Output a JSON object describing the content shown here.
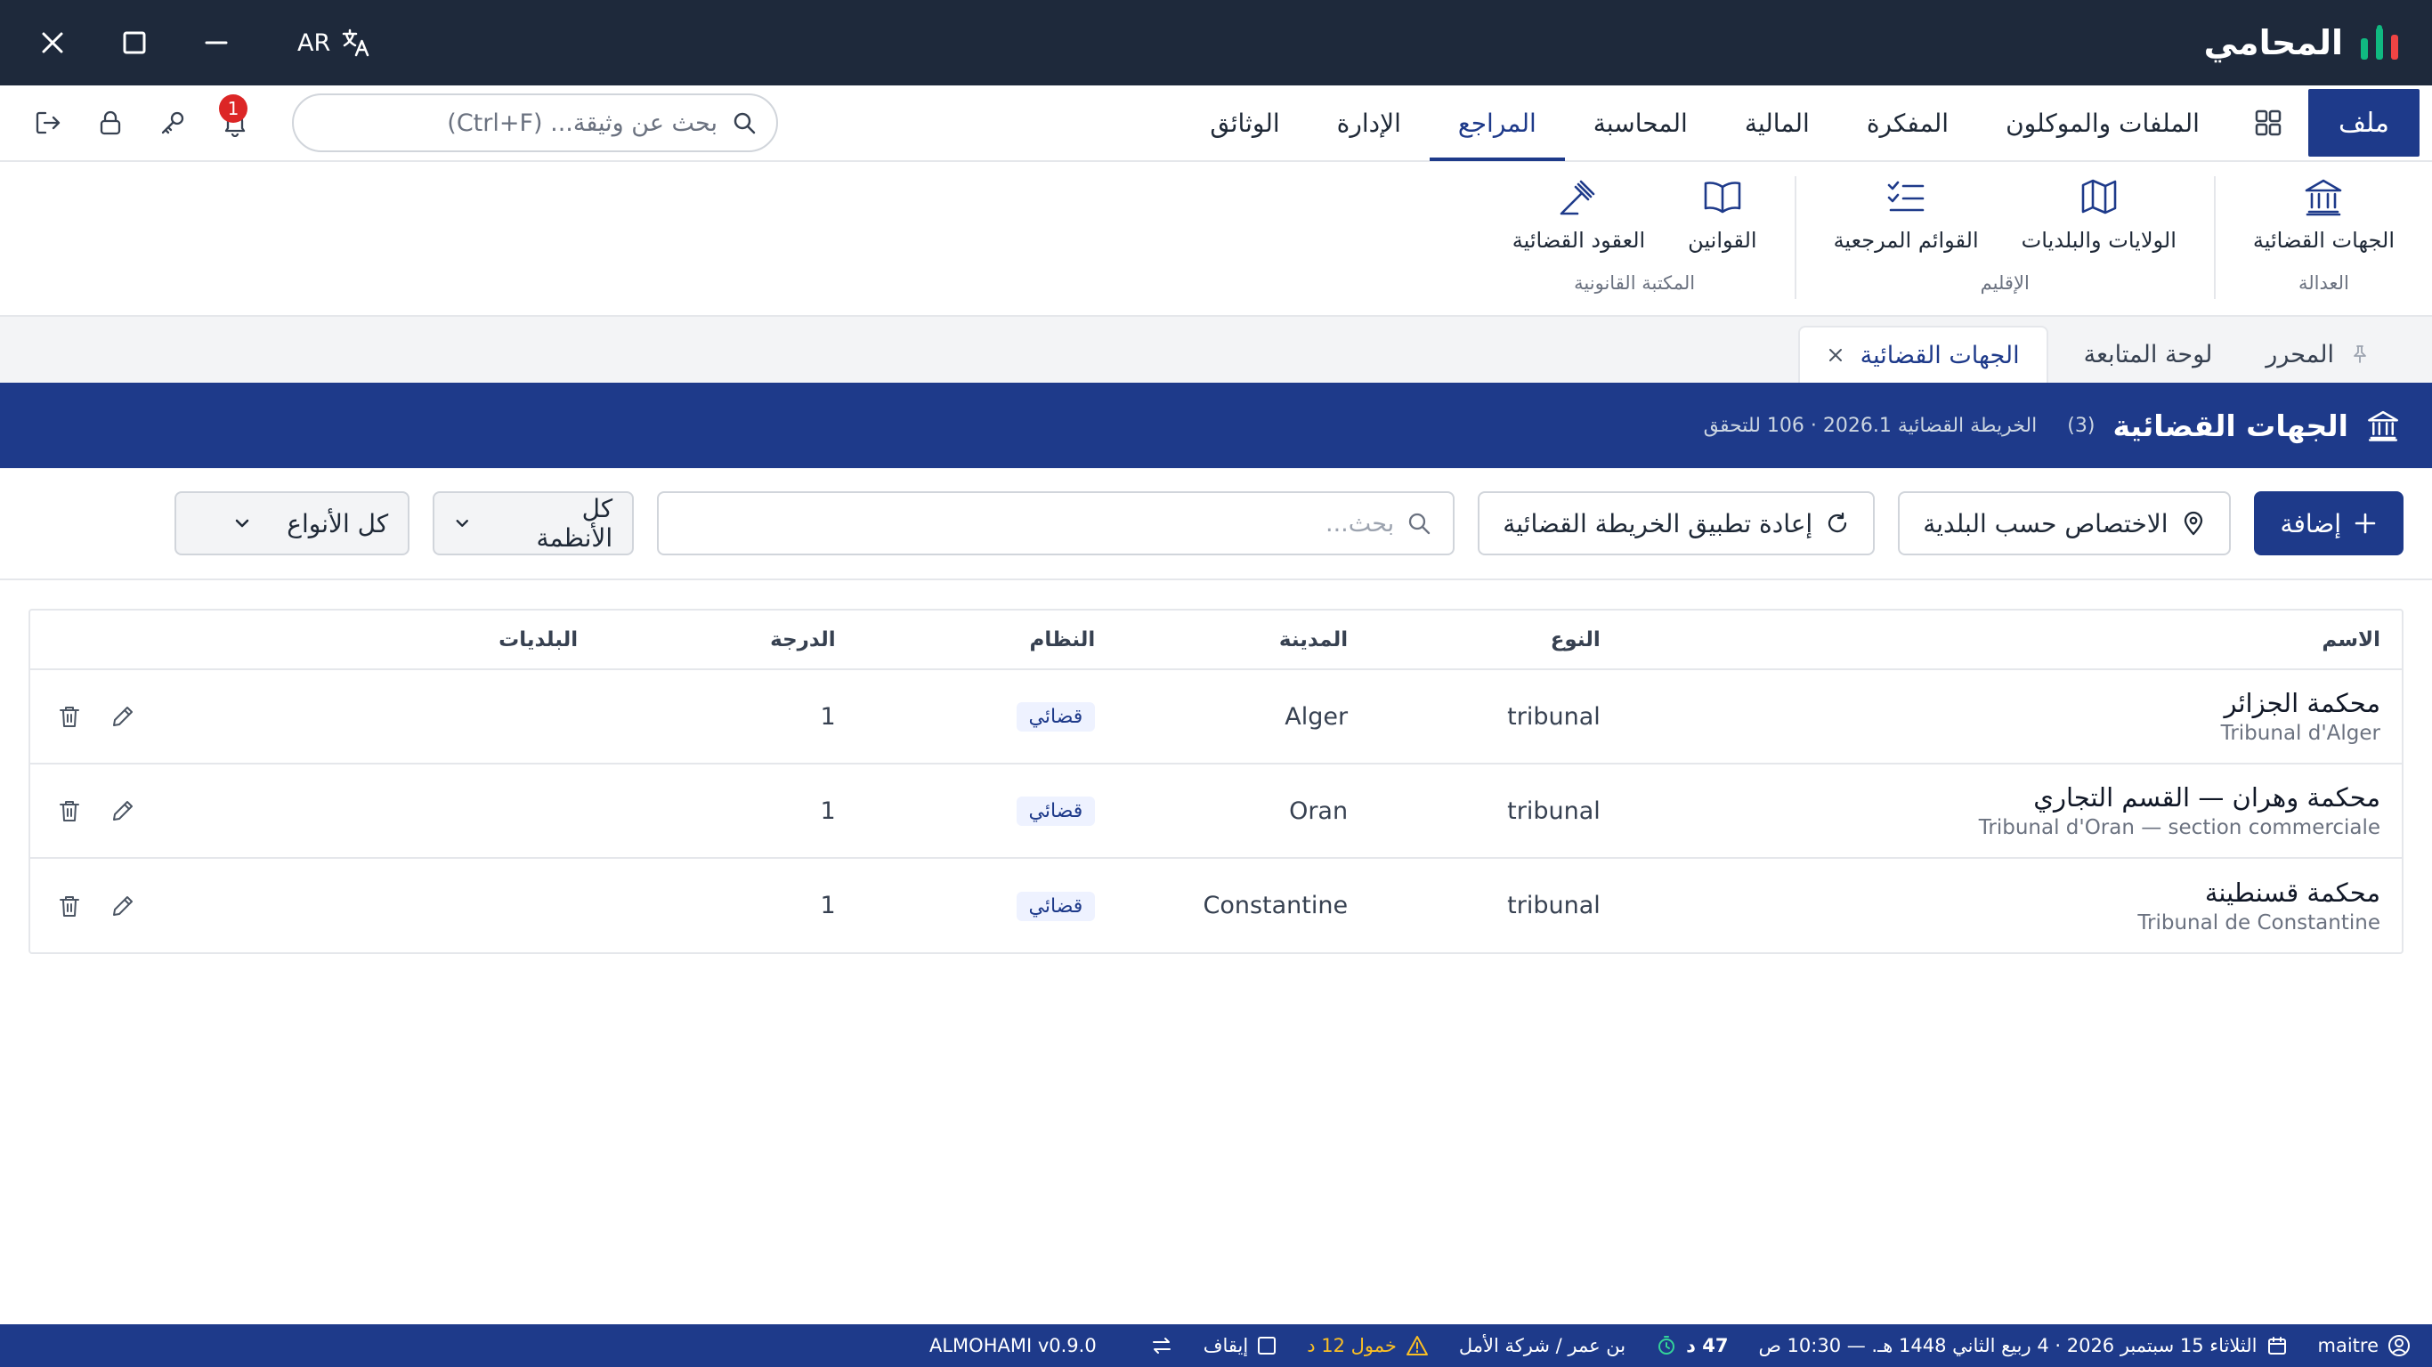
{
  "app": {
    "name": "المحامي",
    "language": "AR",
    "colors": {
      "accent": "#1e3a8a",
      "titlebar": "#1e293b",
      "danger": "#dc2626",
      "warning": "#fbbf24"
    }
  },
  "menubar": {
    "file_label": "ملف",
    "tabs": [
      {
        "label": "الملفات والموكلون"
      },
      {
        "label": "المفكرة"
      },
      {
        "label": "المالية"
      },
      {
        "label": "المحاسبة"
      },
      {
        "label": "المراجع",
        "active": true
      },
      {
        "label": "الإدارة"
      },
      {
        "label": "الوثائق"
      }
    ],
    "search_placeholder": "بحث عن وثيقة... (Ctrl+F)",
    "notification_count": "1"
  },
  "ribbon": {
    "groups": [
      {
        "label": "العدالة",
        "items": [
          {
            "label": "الجهات القضائية",
            "icon": "landmark-icon"
          }
        ]
      },
      {
        "label": "الإقليم",
        "items": [
          {
            "label": "الولايات والبلديات",
            "icon": "map-icon"
          },
          {
            "label": "القوائم المرجعية",
            "icon": "list-checks-icon"
          }
        ]
      },
      {
        "label": "المكتبة القانونية",
        "items": [
          {
            "label": "القوانين",
            "icon": "book-open-icon"
          },
          {
            "label": "العقود القضائية",
            "icon": "gavel-icon"
          }
        ]
      }
    ]
  },
  "doctabs": [
    {
      "label": "المحرر",
      "pinned": true
    },
    {
      "label": "لوحة المتابعة"
    },
    {
      "label": "الجهات القضائية",
      "active": true,
      "closable": true
    }
  ],
  "page": {
    "title": "الجهات القضائية",
    "count": "(3)",
    "subtitle": "الخريطة القضائية 2026.1 · 106 للتحقق"
  },
  "toolbar": {
    "add_label": "إضافة",
    "by_municipality_label": "الاختصاص حسب البلدية",
    "reapply_label": "إعادة تطبيق الخريطة القضائية",
    "search_placeholder": "بحث...",
    "systems_select": "كل الأنظمة",
    "types_select": "كل الأنواع"
  },
  "table": {
    "columns": {
      "name": "الاسم",
      "type": "النوع",
      "city": "المدينة",
      "system": "النظام",
      "degree": "الدرجة",
      "municipalities": "البلديات"
    },
    "rows": [
      {
        "name_ar": "محكمة الجزائر",
        "name_fr": "Tribunal d'Alger",
        "type": "tribunal",
        "city": "Alger",
        "system": "قضائي",
        "degree": "1",
        "municipalities": ""
      },
      {
        "name_ar": "محكمة وهران — القسم التجاري",
        "name_fr": "Tribunal d'Oran — section commerciale",
        "type": "tribunal",
        "city": "Oran",
        "system": "قضائي",
        "degree": "1",
        "municipalities": ""
      },
      {
        "name_ar": "محكمة قسنطينة",
        "name_fr": "Tribunal de Constantine",
        "type": "tribunal",
        "city": "Constantine",
        "system": "قضائي",
        "degree": "1",
        "municipalities": ""
      }
    ]
  },
  "statusbar": {
    "user": "maitre",
    "date": "الثلاثاء 15 سبتمبر 2026 · 4 ربيع الثاني 1448 هـ. — 10:30 ص",
    "timer": "47 د",
    "client": "بن عمر / شركة الأمل",
    "warning": "خمول 12 د",
    "pause_label": "إيقاف",
    "version": "ALMOHAMI v0.9.0"
  }
}
